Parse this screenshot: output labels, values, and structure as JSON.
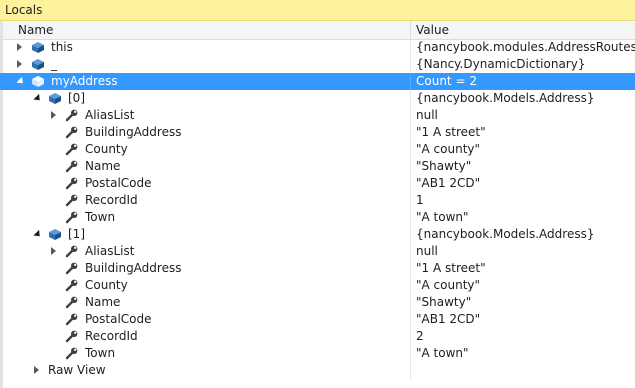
{
  "window": {
    "title": "Locals"
  },
  "columns": {
    "name": "Name",
    "value": "Value"
  },
  "rows": [
    {
      "name": "this",
      "value": "{nancybook.modules.AddressRoutes}",
      "expander": "collapsed",
      "icon": "object-icon",
      "level": 0
    },
    {
      "name": "_",
      "value": "{Nancy.DynamicDictionary}",
      "expander": "collapsed",
      "icon": "object-icon",
      "level": 0
    },
    {
      "name": "myAddress",
      "value": "Count = 2",
      "expander": "expanded",
      "icon": "object-icon",
      "level": 0,
      "selected": true
    },
    {
      "name": "[0]",
      "value": "{nancybook.Models.Address}",
      "expander": "expanded",
      "icon": "object-icon",
      "level": 1
    },
    {
      "name": "AliasList",
      "value": "null",
      "expander": "collapsed",
      "icon": "property-icon",
      "level": 2
    },
    {
      "name": "BuildingAddress",
      "value": "\"1 A street\"",
      "expander": "none",
      "icon": "property-icon",
      "level": 2
    },
    {
      "name": "County",
      "value": "\"A county\"",
      "expander": "none",
      "icon": "property-icon",
      "level": 2
    },
    {
      "name": "Name",
      "value": "\"Shawty\"",
      "expander": "none",
      "icon": "property-icon",
      "level": 2
    },
    {
      "name": "PostalCode",
      "value": "\"AB1 2CD\"",
      "expander": "none",
      "icon": "property-icon",
      "level": 2
    },
    {
      "name": "RecordId",
      "value": "1",
      "expander": "none",
      "icon": "property-icon",
      "level": 2
    },
    {
      "name": "Town",
      "value": "\"A town\"",
      "expander": "none",
      "icon": "property-icon",
      "level": 2
    },
    {
      "name": "[1]",
      "value": "{nancybook.Models.Address}",
      "expander": "expanded",
      "icon": "object-icon",
      "level": 1
    },
    {
      "name": "AliasList",
      "value": "null",
      "expander": "collapsed",
      "icon": "property-icon",
      "level": 2
    },
    {
      "name": "BuildingAddress",
      "value": "\"1 A street\"",
      "expander": "none",
      "icon": "property-icon",
      "level": 2
    },
    {
      "name": "County",
      "value": "\"A county\"",
      "expander": "none",
      "icon": "property-icon",
      "level": 2
    },
    {
      "name": "Name",
      "value": "\"Shawty\"",
      "expander": "none",
      "icon": "property-icon",
      "level": 2
    },
    {
      "name": "PostalCode",
      "value": "\"AB1 2CD\"",
      "expander": "none",
      "icon": "property-icon",
      "level": 2
    },
    {
      "name": "RecordId",
      "value": "2",
      "expander": "none",
      "icon": "property-icon",
      "level": 2
    },
    {
      "name": "Town",
      "value": "\"A town\"",
      "expander": "none",
      "icon": "property-icon",
      "level": 2
    },
    {
      "name": "Raw View",
      "value": "",
      "expander": "collapsed",
      "icon": "raw-view-icon",
      "level": 1
    }
  ],
  "colors": {
    "title_bar": "#fff29d",
    "selection": "#3399ff",
    "object_icon": "#2d6fb5"
  }
}
